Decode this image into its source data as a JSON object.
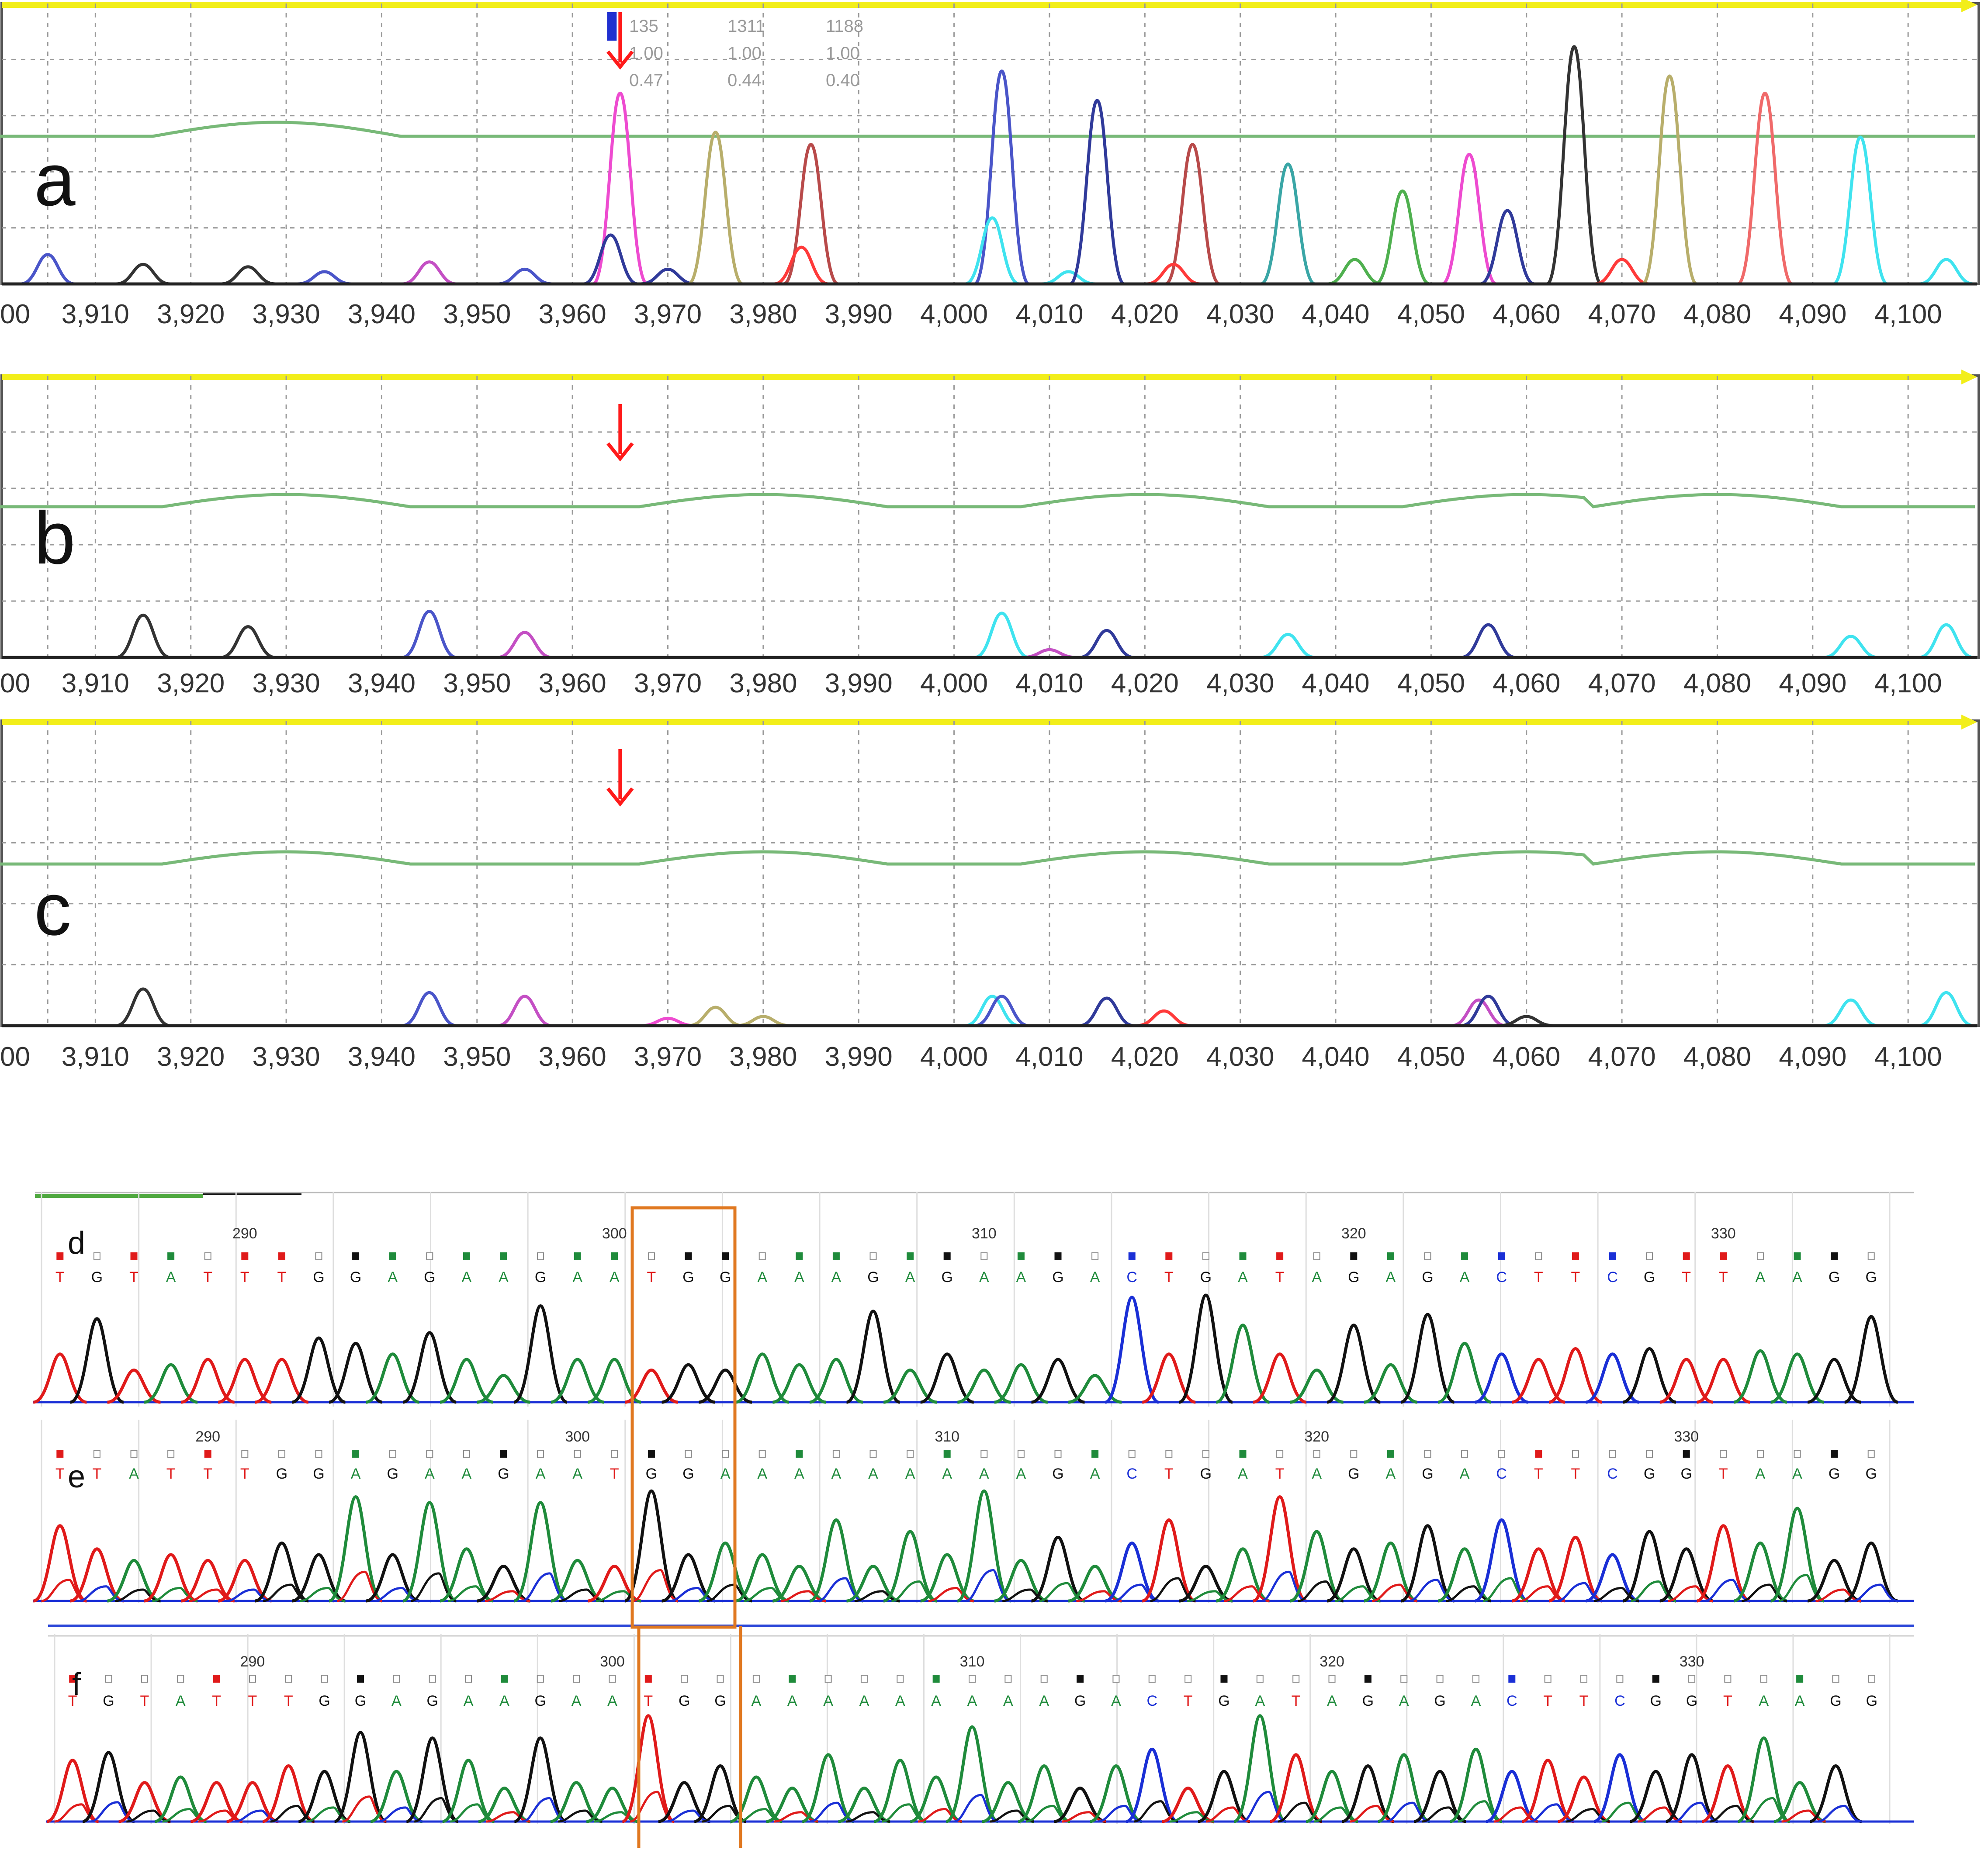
{
  "colors": {
    "A": "#1f8b3b",
    "C": "#1a2fd6",
    "G": "#111111",
    "T": "#e01a1a",
    "fragment_blue": "#4a55c9",
    "fragment_navy": "#303a9a",
    "fragment_pink": "#ee4bd0",
    "fragment_olive": "#b8ae6b",
    "fragment_brown": "#b84a4a",
    "fragment_teal": "#3aa6a6",
    "fragment_green": "#4fb04f",
    "fragment_black": "#333333",
    "fragment_salmon": "#f06a6a",
    "fragment_cyan": "#3fe3ef",
    "fragment_magenta": "#c44fc4",
    "fragment_red": "#ff3a3a",
    "reference_line": "#78b978",
    "top_bar": "#f2ee1a",
    "arrow": "#ff1a1a",
    "box": "#e07820"
  },
  "chart_data": [
    {
      "type": "line",
      "panel_label": "a",
      "x_ticks": [
        "3,910",
        "3,920",
        "3,930",
        "3,940",
        "3,950",
        "3,960",
        "3,970",
        "3,980",
        "3,990",
        "4,000",
        "4,010",
        "4,020",
        "4,030",
        "4,040",
        "4,050",
        "4,060",
        "4,070",
        "4,080",
        "4,090",
        "4,100"
      ],
      "x_tick_values": [
        3910,
        3920,
        3930,
        3940,
        3950,
        3960,
        3970,
        3980,
        3990,
        4000,
        4010,
        4020,
        4030,
        4040,
        4050,
        4060,
        4070,
        4080,
        4090,
        4100
      ],
      "xlim": [
        3900,
        4107
      ],
      "arrow_at": 3965,
      "readout_rows": [
        [
          "135",
          "1311",
          "1188"
        ],
        [
          "1.00",
          "1.00",
          "1.00"
        ],
        [
          "0.47",
          "0.44",
          "0.40"
        ]
      ],
      "peaks": [
        {
          "x": 3905,
          "h": 0.12,
          "color": "fragment_blue"
        },
        {
          "x": 3915,
          "h": 0.08,
          "color": "fragment_black"
        },
        {
          "x": 3926,
          "h": 0.07,
          "color": "fragment_black"
        },
        {
          "x": 3934,
          "h": 0.05,
          "color": "fragment_blue"
        },
        {
          "x": 3945,
          "h": 0.09,
          "color": "fragment_magenta"
        },
        {
          "x": 3955,
          "h": 0.06,
          "color": "fragment_blue"
        },
        {
          "x": 3965,
          "h": 0.78,
          "color": "fragment_pink"
        },
        {
          "x": 3964,
          "h": 0.2,
          "color": "fragment_navy"
        },
        {
          "x": 3970,
          "h": 0.06,
          "color": "fragment_navy"
        },
        {
          "x": 3975,
          "h": 0.62,
          "color": "fragment_olive"
        },
        {
          "x": 3985,
          "h": 0.57,
          "color": "fragment_brown"
        },
        {
          "x": 3984,
          "h": 0.15,
          "color": "fragment_red"
        },
        {
          "x": 4005,
          "h": 0.87,
          "color": "fragment_blue"
        },
        {
          "x": 4004,
          "h": 0.27,
          "color": "fragment_cyan"
        },
        {
          "x": 4012,
          "h": 0.05,
          "color": "fragment_cyan"
        },
        {
          "x": 4015,
          "h": 0.75,
          "color": "fragment_navy"
        },
        {
          "x": 4025,
          "h": 0.57,
          "color": "fragment_brown"
        },
        {
          "x": 4023,
          "h": 0.08,
          "color": "fragment_red"
        },
        {
          "x": 4035,
          "h": 0.49,
          "color": "fragment_teal"
        },
        {
          "x": 4042,
          "h": 0.1,
          "color": "fragment_green"
        },
        {
          "x": 4047,
          "h": 0.38,
          "color": "fragment_green"
        },
        {
          "x": 4054,
          "h": 0.53,
          "color": "fragment_pink"
        },
        {
          "x": 4058,
          "h": 0.3,
          "color": "fragment_navy"
        },
        {
          "x": 4065,
          "h": 0.97,
          "color": "fragment_black"
        },
        {
          "x": 4070,
          "h": 0.1,
          "color": "fragment_red"
        },
        {
          "x": 4075,
          "h": 0.85,
          "color": "fragment_olive"
        },
        {
          "x": 4085,
          "h": 0.78,
          "color": "fragment_salmon"
        },
        {
          "x": 4095,
          "h": 0.6,
          "color": "fragment_cyan"
        },
        {
          "x": 4104,
          "h": 0.1,
          "color": "fragment_cyan"
        }
      ]
    },
    {
      "type": "line",
      "panel_label": "b",
      "x_ticks": [
        "3,910",
        "3,920",
        "3,930",
        "3,940",
        "3,950",
        "3,960",
        "3,970",
        "3,980",
        "3,990",
        "4,000",
        "4,010",
        "4,020",
        "4,030",
        "4,040",
        "4,050",
        "4,060",
        "4,070",
        "4,080",
        "4,090",
        "4,100"
      ],
      "x_tick_values": [
        3910,
        3920,
        3930,
        3940,
        3950,
        3960,
        3970,
        3980,
        3990,
        4000,
        4010,
        4020,
        4030,
        4040,
        4050,
        4060,
        4070,
        4080,
        4090,
        4100
      ],
      "xlim": [
        3900,
        4107
      ],
      "arrow_at": 3965,
      "peaks": [
        {
          "x": 3915,
          "h": 0.22,
          "color": "fragment_black"
        },
        {
          "x": 3926,
          "h": 0.16,
          "color": "fragment_black"
        },
        {
          "x": 3945,
          "h": 0.24,
          "color": "fragment_blue"
        },
        {
          "x": 3955,
          "h": 0.13,
          "color": "fragment_magenta"
        },
        {
          "x": 4005,
          "h": 0.23,
          "color": "fragment_cyan"
        },
        {
          "x": 4010,
          "h": 0.04,
          "color": "fragment_magenta"
        },
        {
          "x": 4016,
          "h": 0.14,
          "color": "fragment_navy"
        },
        {
          "x": 4035,
          "h": 0.12,
          "color": "fragment_cyan"
        },
        {
          "x": 4056,
          "h": 0.17,
          "color": "fragment_navy"
        },
        {
          "x": 4094,
          "h": 0.11,
          "color": "fragment_cyan"
        },
        {
          "x": 4104,
          "h": 0.17,
          "color": "fragment_cyan"
        }
      ]
    },
    {
      "type": "line",
      "panel_label": "c",
      "x_ticks": [
        "3,910",
        "3,920",
        "3,930",
        "3,940",
        "3,950",
        "3,960",
        "3,970",
        "3,980",
        "3,990",
        "4,000",
        "4,010",
        "4,020",
        "4,030",
        "4,040",
        "4,050",
        "4,060",
        "4,070",
        "4,080",
        "4,090",
        "4,100"
      ],
      "x_tick_values": [
        3910,
        3920,
        3930,
        3940,
        3950,
        3960,
        3970,
        3980,
        3990,
        4000,
        4010,
        4020,
        4030,
        4040,
        4050,
        4060,
        4070,
        4080,
        4090,
        4100
      ],
      "xlim": [
        3900,
        4107
      ],
      "arrow_at": 3965,
      "peaks": [
        {
          "x": 3915,
          "h": 0.2,
          "color": "fragment_black"
        },
        {
          "x": 3945,
          "h": 0.18,
          "color": "fragment_blue"
        },
        {
          "x": 3955,
          "h": 0.16,
          "color": "fragment_magenta"
        },
        {
          "x": 3970,
          "h": 0.04,
          "color": "fragment_pink"
        },
        {
          "x": 3975,
          "h": 0.1,
          "color": "fragment_olive"
        },
        {
          "x": 3980,
          "h": 0.05,
          "color": "fragment_olive"
        },
        {
          "x": 4004,
          "h": 0.16,
          "color": "fragment_cyan"
        },
        {
          "x": 4005,
          "h": 0.16,
          "color": "fragment_blue"
        },
        {
          "x": 4016,
          "h": 0.15,
          "color": "fragment_navy"
        },
        {
          "x": 4022,
          "h": 0.08,
          "color": "fragment_red"
        },
        {
          "x": 4055,
          "h": 0.14,
          "color": "fragment_magenta"
        },
        {
          "x": 4056,
          "h": 0.16,
          "color": "fragment_navy"
        },
        {
          "x": 4060,
          "h": 0.05,
          "color": "fragment_black"
        },
        {
          "x": 4094,
          "h": 0.14,
          "color": "fragment_cyan"
        },
        {
          "x": 4104,
          "h": 0.18,
          "color": "fragment_cyan"
        }
      ]
    },
    {
      "type": "line",
      "panel_label": "d",
      "position_labels": [
        {
          "pos": 290,
          "label": "290"
        },
        {
          "pos": 300,
          "label": "300"
        },
        {
          "pos": 310,
          "label": "310"
        },
        {
          "pos": 320,
          "label": "320"
        },
        {
          "pos": 330,
          "label": "330"
        }
      ],
      "bases": "TGTATTTGGAGAAGAATGGAAAGAGAAGACTGATAGAGACTTCGTTAAGG",
      "first_position": 285,
      "highlight_positions": [
        301,
        303
      ],
      "peak_heights": [
        0.45,
        0.78,
        0.3,
        0.35,
        0.4,
        0.4,
        0.4,
        0.6,
        0.55,
        0.45,
        0.65,
        0.4,
        0.25,
        0.9,
        0.4,
        0.4,
        0.3,
        0.35,
        0.3,
        0.45,
        0.35,
        0.4,
        0.85,
        0.3,
        0.45,
        0.3,
        0.35,
        0.4,
        0.25,
        0.98,
        0.45,
        1.0,
        0.72,
        0.45,
        0.3,
        0.72,
        0.35,
        0.82,
        0.55,
        0.45,
        0.4,
        0.5,
        0.45,
        0.5,
        0.4,
        0.4,
        0.48,
        0.45,
        0.4,
        0.8
      ]
    },
    {
      "type": "line",
      "panel_label": "e",
      "position_labels": [
        {
          "pos": 290,
          "label": "290"
        },
        {
          "pos": 300,
          "label": "300"
        },
        {
          "pos": 310,
          "label": "310"
        },
        {
          "pos": 320,
          "label": "320"
        },
        {
          "pos": 330,
          "label": "330"
        }
      ],
      "bases": "TTATTTGGAGAAGAATGGAAAAAAAAAGACTGATAGAGACTTCGGTAAGG",
      "first_position": 286,
      "highlight_positions": [
        301,
        303
      ],
      "peak_heights": [
        0.65,
        0.45,
        0.35,
        0.4,
        0.35,
        0.35,
        0.5,
        0.4,
        0.9,
        0.4,
        0.85,
        0.45,
        0.3,
        0.85,
        0.35,
        0.3,
        0.95,
        0.4,
        0.5,
        0.4,
        0.3,
        0.7,
        0.3,
        0.6,
        0.4,
        0.95,
        0.35,
        0.55,
        0.3,
        0.5,
        0.7,
        0.3,
        0.45,
        0.9,
        0.6,
        0.45,
        0.5,
        0.65,
        0.45,
        0.7,
        0.45,
        0.55,
        0.4,
        0.6,
        0.45,
        0.65,
        0.5,
        0.8,
        0.35,
        0.5
      ]
    },
    {
      "type": "line",
      "panel_label": "f",
      "position_labels": [
        {
          "pos": 290,
          "label": "290"
        },
        {
          "pos": 300,
          "label": "300"
        },
        {
          "pos": 310,
          "label": "310"
        },
        {
          "pos": 320,
          "label": "320"
        },
        {
          "pos": 330,
          "label": "330"
        }
      ],
      "bases": "TGTATTTGGAGAAGAATGGAAAAAAAAAGACTGATAGAGACTTCGGTAAGG",
      "first_position": 285,
      "highlight_positions": [
        301,
        303
      ],
      "peak_heights": [
        0.55,
        0.62,
        0.35,
        0.4,
        0.35,
        0.35,
        0.5,
        0.45,
        0.8,
        0.45,
        0.75,
        0.55,
        0.3,
        0.75,
        0.35,
        0.3,
        0.95,
        0.35,
        0.5,
        0.4,
        0.3,
        0.6,
        0.3,
        0.55,
        0.4,
        0.85,
        0.35,
        0.5,
        0.3,
        0.5,
        0.65,
        0.3,
        0.45,
        0.95,
        0.6,
        0.45,
        0.5,
        0.6,
        0.45,
        0.65,
        0.45,
        0.55,
        0.4,
        0.6,
        0.45,
        0.6,
        0.5,
        0.75,
        0.35,
        0.5
      ]
    }
  ]
}
